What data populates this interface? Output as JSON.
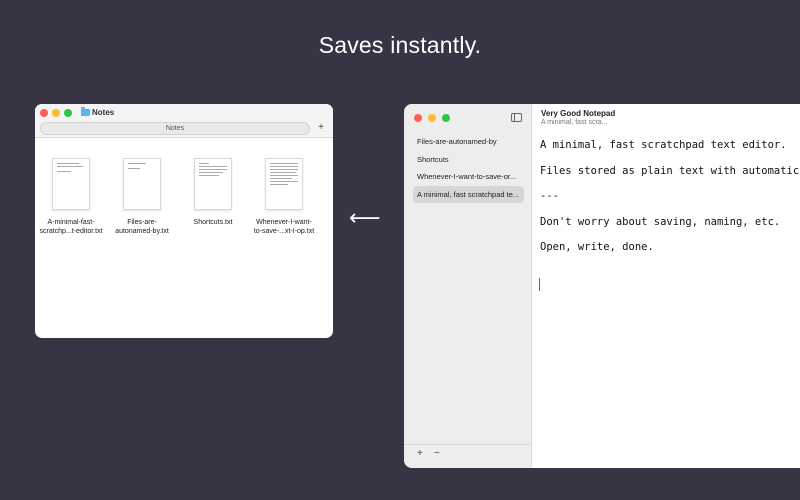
{
  "headline": "Saves instantly.",
  "finder": {
    "title": "Notes",
    "tab_label": "Notes",
    "add_tab": "+",
    "files": [
      {
        "name_line1": "A-minimal-fast-",
        "name_line2": "scratchp...t-editor.txt"
      },
      {
        "name_line1": "Files-are-",
        "name_line2": "autonamed-by.txt"
      },
      {
        "name_line1": "Shortcuts.txt",
        "name_line2": ""
      },
      {
        "name_line1": "Whenever-I-want-",
        "name_line2": "to-save-...xt-I-op.txt"
      }
    ]
  },
  "arrow": "⟵",
  "notepad": {
    "app_title": "Very Good Notepad",
    "subtitle": "A minimal, fast scra...",
    "notes": [
      "Files-are-autonamed-by",
      "Shortcuts",
      "Whenever-I-want-to-save-or...",
      "A minimal, fast scratchpad te..."
    ],
    "selected_index": 3,
    "add_label": "+",
    "remove_label": "−",
    "editor_lines": [
      "A minimal, fast scratchpad text editor.",
      "Files stored as plain text with automatic sa",
      "---",
      "Don't worry about saving, naming, etc.",
      "Open, write, done."
    ]
  }
}
